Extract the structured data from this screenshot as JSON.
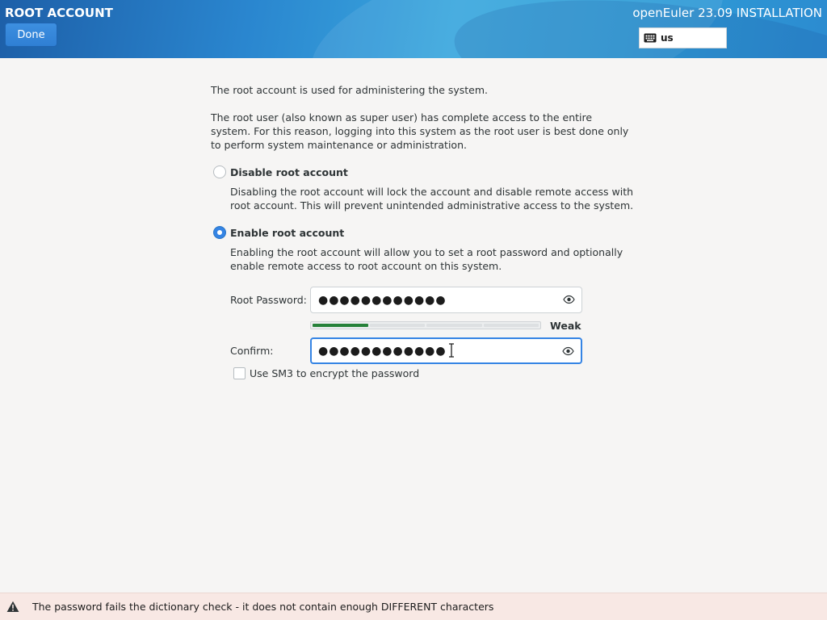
{
  "header": {
    "title": "ROOT ACCOUNT",
    "done_label": "Done",
    "product": "openEuler 23.09 INSTALLATION",
    "keyboard_layout": "us"
  },
  "intro": {
    "line1": "The root account is used for administering the system.",
    "line2": "The root user (also known as super user) has complete access to the entire system. For this reason, logging into this system as the root user is best done only to perform system maintenance or administration."
  },
  "options": {
    "disable": {
      "label": "Disable root account",
      "description": "Disabling the root account will lock the account and disable remote access with root account. This will prevent unintended administrative access to the system.",
      "selected": false
    },
    "enable": {
      "label": "Enable root account",
      "description": "Enabling the root account will allow you to set a root password and optionally enable remote access to root account on this system.",
      "selected": true
    }
  },
  "form": {
    "root_password_label": "Root Password:",
    "root_password_value": "●●●●●●●●●●●●",
    "confirm_label": "Confirm:",
    "confirm_value": "●●●●●●●●●●●●",
    "strength_label": "Weak",
    "strength_fraction": 0.25,
    "sm3_label": "Use SM3 to encrypt the password",
    "sm3_checked": false
  },
  "warning": {
    "message": "The password fails the dictionary check - it does not contain enough DIFFERENT characters"
  },
  "colors": {
    "accent": "#3584e4",
    "strength_weak": "#26813a",
    "warning_bg": "#f8e8e4"
  }
}
